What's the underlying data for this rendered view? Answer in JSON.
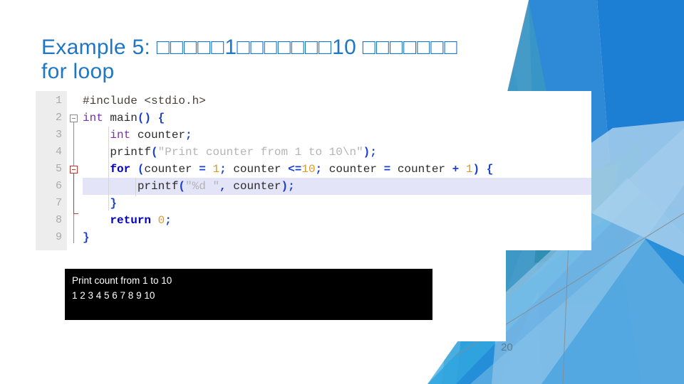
{
  "slide": {
    "title_prefix": "Example 5: ",
    "title_tofu_1": "□□□□□",
    "title_num_1": "1",
    "title_tofu_2": "□□□□□□□",
    "title_num_2": "10",
    "title_tofu_3": "□□□□□□□",
    "title_line2": "for loop",
    "page_number": "20"
  },
  "editor": {
    "line_numbers": [
      "1",
      "2",
      "3",
      "4",
      "5",
      "6",
      "7",
      "8",
      "9"
    ],
    "highlighted_line": "6",
    "lines": [
      {
        "n": "1",
        "text": "#include <stdio.h>"
      },
      {
        "n": "2",
        "text": "int main() {"
      },
      {
        "n": "3",
        "text": "    int counter;"
      },
      {
        "n": "4",
        "text": "    printf(\"Print counter from 1 to 10\\n\");"
      },
      {
        "n": "5",
        "text": "    for (counter = 1; counter <=10; counter = counter + 1) {"
      },
      {
        "n": "6",
        "text": "        printf(\"%d \", counter);"
      },
      {
        "n": "7",
        "text": "    }"
      },
      {
        "n": "8",
        "text": "    return 0;"
      },
      {
        "n": "9",
        "text": "}"
      }
    ],
    "tokens": {
      "include_directive": "#include <stdio.h>",
      "kw_int": "int",
      "kw_for": "for",
      "kw_return": "return",
      "fn_main": "main",
      "fn_printf": "printf",
      "var_counter": "counter",
      "str_print_counter": "\"Print counter from 1 to 10\\n\"",
      "str_format_d": "\"%d \"",
      "num_1": "1",
      "num_10": "10",
      "num_0": "0",
      "op_assign": "=",
      "op_lte": "<=",
      "op_plus": "+"
    },
    "colors": {
      "keyword_type": "#7B2FA8",
      "keyword_control": "#0000C0",
      "number": "#D99A2B",
      "string": "#B4B4B4",
      "punctuation": "#1A3FD0",
      "gutter_bg": "#EDEDED",
      "gutter_text": "#A9A9A9",
      "current_line_bg": "#E4E4F8",
      "fold_marker_active": "#C0392B"
    }
  },
  "console": {
    "line1": "Print count from 1 to 10",
    "line2": "1 2 3 4 5 6 7 8 9 10",
    "bg": "#000000",
    "fg": "#FFFFFF"
  },
  "theme": {
    "title_blue": "#1F77C4",
    "page_number_color": "#5E7C8C",
    "slide_bg": "#FFFFFF"
  }
}
